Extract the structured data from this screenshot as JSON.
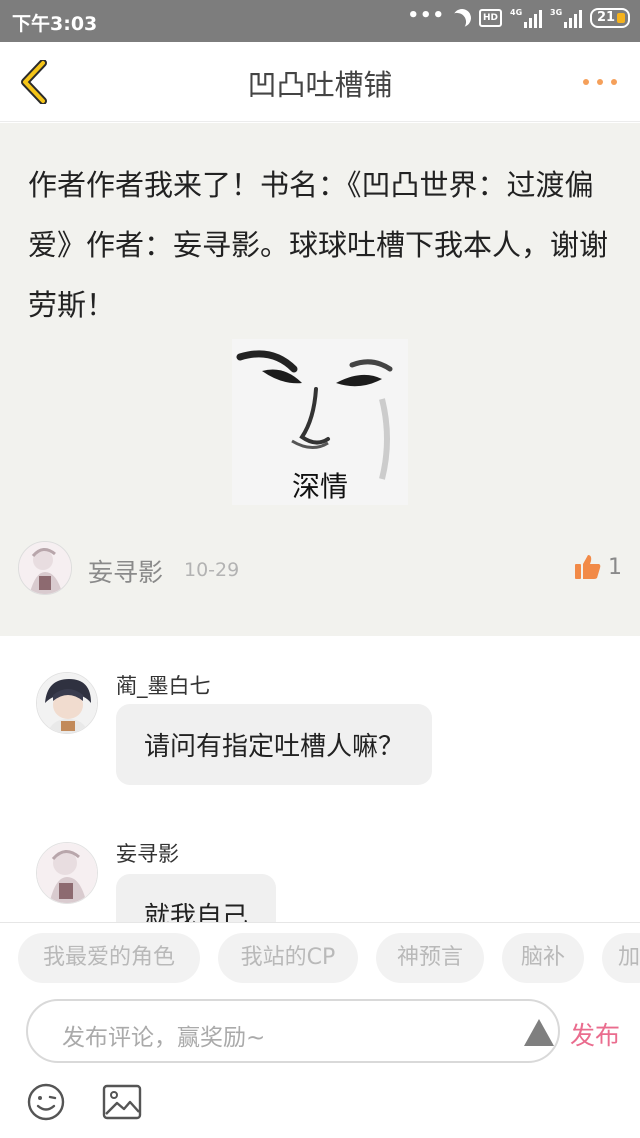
{
  "status_bar": {
    "time": "下午3:03",
    "hd_label": "HD",
    "net1_label": "4G",
    "net2_label": "3G",
    "battery": "21"
  },
  "header": {
    "title": "凹凸吐槽铺",
    "back_icon": "chevron-left-icon",
    "more_icon": "more-dots-icon",
    "accent": "#f5a623"
  },
  "post": {
    "text": "作者作者我来了！书名：《凹凸世界：过渡偏爱》作者：妄寻影。球球吐槽下我本人，谢谢劳斯！",
    "image_caption": "深情",
    "author": "妄寻影",
    "date": "10-29",
    "likes": "1",
    "like_color": "#f28a47"
  },
  "comments": [
    {
      "name": "蔺_墨白七",
      "text": "请问有指定吐槽人嘛？"
    },
    {
      "name": "妄寻影",
      "text": "就我自己"
    }
  ],
  "tags": [
    "我最爱的角色",
    "我站的CP",
    "神预言",
    "脑补",
    "加"
  ],
  "input": {
    "placeholder": "发布评论，赢奖励~",
    "publish_label": "发布",
    "publish_color": "#ea6c8e"
  },
  "toolbar": {
    "emoji_icon": "emoji-icon",
    "image_icon": "image-icon"
  }
}
